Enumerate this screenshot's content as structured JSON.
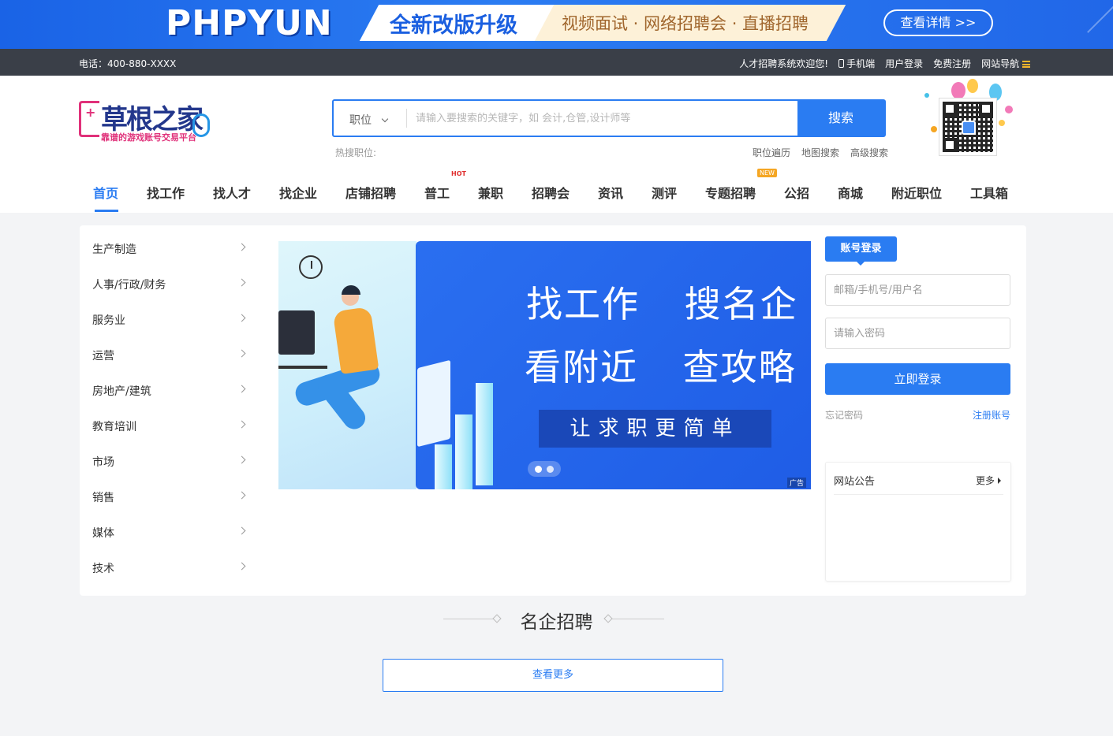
{
  "banner": {
    "brand": "PHPYUN",
    "headline": "全新改版升级",
    "features": "视频面试 · 网络招聘会 · 直播招聘",
    "detail_button": "查看详情 >>"
  },
  "topbar": {
    "phone": "电话：400-880-XXXX",
    "welcome": "人才招聘系统欢迎您!",
    "mobile": "手机端",
    "login": "用户登录",
    "register": "免费注册",
    "site_nav": "网站导航"
  },
  "logo": {
    "name": "草根之家",
    "slogan": "靠谱的游戏账号交易平台"
  },
  "search": {
    "type_selected": "职位",
    "placeholder": "请输入要搜索的关键字，如 会计,仓管,设计师等",
    "button": "搜索",
    "hot_label": "热搜职位:",
    "links": [
      "职位遍历",
      "地图搜索",
      "高级搜索"
    ]
  },
  "nav": {
    "items": [
      "首页",
      "找工作",
      "找人才",
      "找企业",
      "店铺招聘",
      "普工",
      "兼职",
      "招聘会",
      "资讯",
      "测评",
      "专题招聘",
      "公招",
      "商城",
      "附近职位",
      "工具箱"
    ],
    "active_index": 0,
    "hot_badge": "HOT",
    "new_badge": "NEW"
  },
  "categories": [
    "生产制造",
    "人事/行政/财务",
    "服务业",
    "运营",
    "房地产/建筑",
    "教育培训",
    "市场",
    "销售",
    "媒体",
    "技术"
  ],
  "slider": {
    "line1": "找工作 搜名企",
    "line2": "看附近 查攻略",
    "subline": "让求职更简单",
    "ad_tag": "广告",
    "dot_count": 2,
    "active_dot": 0
  },
  "login": {
    "tab": "账号登录",
    "username_placeholder": "邮箱/手机号/用户名",
    "password_placeholder": "请输入密码",
    "submit": "立即登录",
    "forgot": "忘记密码",
    "register": "注册账号"
  },
  "notice": {
    "title": "网站公告",
    "more": "更多"
  },
  "section": {
    "title": "名企招聘",
    "more_button": "查看更多"
  },
  "colors": {
    "primary": "#2a7cf2",
    "topbar_bg": "#3a3f48",
    "page_bg": "#f3f4f6",
    "logo_pink": "#e0317a",
    "logo_navy": "#23378c"
  }
}
